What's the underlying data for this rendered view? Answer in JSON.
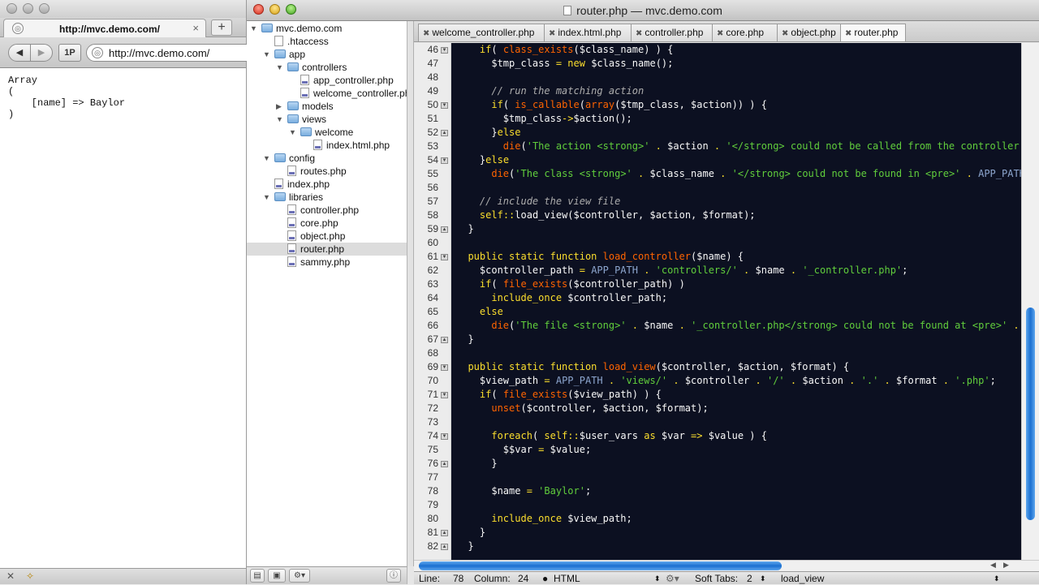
{
  "browser": {
    "tab_title": "http://mvc.demo.com/",
    "close_glyph": "×",
    "new_tab_glyph": "+",
    "back_glyph": "◀",
    "forward_glyph": "▶",
    "oneP_label": "1P",
    "url": "http://mvc.demo.com/",
    "page_output": "Array\n(\n    [name] => Baylor\n)",
    "status_left": "✕",
    "status_icon": "wand-icon"
  },
  "editor": {
    "window_title": "router.php — mvc.demo.com",
    "tree": [
      {
        "label": "mvc.demo.com",
        "type": "folder",
        "depth": 0,
        "open": true
      },
      {
        "label": ".htaccess",
        "type": "file",
        "depth": 1
      },
      {
        "label": "app",
        "type": "folder",
        "depth": 1,
        "open": true
      },
      {
        "label": "controllers",
        "type": "folder",
        "depth": 2,
        "open": true
      },
      {
        "label": "app_controller.php",
        "type": "php",
        "depth": 3
      },
      {
        "label": "welcome_controller.php",
        "type": "php",
        "depth": 3
      },
      {
        "label": "models",
        "type": "folder",
        "depth": 2,
        "open": false
      },
      {
        "label": "views",
        "type": "folder",
        "depth": 2,
        "open": true
      },
      {
        "label": "welcome",
        "type": "folder",
        "depth": 3,
        "open": true
      },
      {
        "label": "index.html.php",
        "type": "php",
        "depth": 4
      },
      {
        "label": "config",
        "type": "folder",
        "depth": 1,
        "open": true
      },
      {
        "label": "routes.php",
        "type": "php",
        "depth": 2
      },
      {
        "label": "index.php",
        "type": "php",
        "depth": 1
      },
      {
        "label": "libraries",
        "type": "folder",
        "depth": 1,
        "open": true
      },
      {
        "label": "controller.php",
        "type": "php",
        "depth": 2
      },
      {
        "label": "core.php",
        "type": "php",
        "depth": 2
      },
      {
        "label": "object.php",
        "type": "php",
        "depth": 2
      },
      {
        "label": "router.php",
        "type": "php",
        "depth": 2,
        "selected": true
      },
      {
        "label": "sammy.php",
        "type": "php",
        "depth": 2
      }
    ],
    "tabs": [
      {
        "label": "welcome_controller.php",
        "active": false
      },
      {
        "label": "index.html.php",
        "active": false
      },
      {
        "label": "controller.php",
        "active": false
      },
      {
        "label": "core.php",
        "active": false
      },
      {
        "label": "object.php",
        "active": false
      },
      {
        "label": "router.php",
        "active": true
      }
    ],
    "tab_close_glyph": "✖",
    "first_line_number": 46,
    "fold_open_lines": [
      46,
      50,
      54,
      61,
      69,
      71,
      74
    ],
    "fold_close_lines": [
      52,
      59,
      67,
      76,
      81,
      82
    ],
    "code_lines": [
      [
        [
          "    ",
          ""
        ],
        [
          "if",
          "kw"
        ],
        [
          "( ",
          ""
        ],
        [
          "class_exists",
          "fn"
        ],
        [
          "(",
          ""
        ],
        [
          "$class_name",
          "var"
        ],
        [
          ") ) {",
          ""
        ]
      ],
      [
        [
          "      ",
          ""
        ],
        [
          "$tmp_class",
          "var"
        ],
        [
          " = ",
          "op"
        ],
        [
          "new ",
          "kw"
        ],
        [
          "$class_name",
          "var"
        ],
        [
          "();",
          ""
        ]
      ],
      [
        [
          "",
          ""
        ]
      ],
      [
        [
          "      ",
          ""
        ],
        [
          "// run the matching action",
          "cmt"
        ]
      ],
      [
        [
          "      ",
          ""
        ],
        [
          "if",
          "kw"
        ],
        [
          "( ",
          ""
        ],
        [
          "is_callable",
          "fn"
        ],
        [
          "(",
          ""
        ],
        [
          "array",
          "fn"
        ],
        [
          "(",
          ""
        ],
        [
          "$tmp_class",
          "var"
        ],
        [
          ", ",
          ""
        ],
        [
          "$action",
          "var"
        ],
        [
          ")) ) {",
          ""
        ]
      ],
      [
        [
          "        ",
          ""
        ],
        [
          "$tmp_class",
          "var"
        ],
        [
          "->",
          "op"
        ],
        [
          "$action",
          "var"
        ],
        [
          "();",
          ""
        ]
      ],
      [
        [
          "      ",
          ""
        ],
        [
          "}",
          ""
        ],
        [
          "else",
          "kw"
        ]
      ],
      [
        [
          "        ",
          ""
        ],
        [
          "die",
          "fn"
        ],
        [
          "(",
          ""
        ],
        [
          "'The action <strong>'",
          "str"
        ],
        [
          " . ",
          "op"
        ],
        [
          "$action",
          "var"
        ],
        [
          " . ",
          "op"
        ],
        [
          "'</strong> could not be called from the controller",
          "str"
        ]
      ],
      [
        [
          "    ",
          ""
        ],
        [
          "}",
          ""
        ],
        [
          "else",
          "kw"
        ]
      ],
      [
        [
          "      ",
          ""
        ],
        [
          "die",
          "fn"
        ],
        [
          "(",
          ""
        ],
        [
          "'The class <strong>'",
          "str"
        ],
        [
          " . ",
          "op"
        ],
        [
          "$class_name",
          "var"
        ],
        [
          " . ",
          "op"
        ],
        [
          "'</strong> could not be found in <pre>'",
          "str"
        ],
        [
          " . ",
          "op"
        ],
        [
          "APP_PATH",
          "cst"
        ]
      ],
      [
        [
          "",
          ""
        ]
      ],
      [
        [
          "    ",
          ""
        ],
        [
          "// include the view file",
          "cmt"
        ]
      ],
      [
        [
          "    ",
          ""
        ],
        [
          "self",
          "kw"
        ],
        [
          "::",
          "op"
        ],
        [
          "load_view",
          "var"
        ],
        [
          "(",
          ""
        ],
        [
          "$controller",
          "var"
        ],
        [
          ", ",
          ""
        ],
        [
          "$action",
          "var"
        ],
        [
          ", ",
          ""
        ],
        [
          "$format",
          "var"
        ],
        [
          ");",
          ""
        ]
      ],
      [
        [
          "  }",
          ""
        ]
      ],
      [
        [
          "",
          ""
        ]
      ],
      [
        [
          "  ",
          ""
        ],
        [
          "public static function ",
          "kw"
        ],
        [
          "load_controller",
          "fn"
        ],
        [
          "(",
          ""
        ],
        [
          "$name",
          "var"
        ],
        [
          ") {",
          ""
        ]
      ],
      [
        [
          "    ",
          ""
        ],
        [
          "$controller_path",
          "var"
        ],
        [
          " = ",
          "op"
        ],
        [
          "APP_PATH",
          "cst"
        ],
        [
          " . ",
          "op"
        ],
        [
          "'controllers/'",
          "str"
        ],
        [
          " . ",
          "op"
        ],
        [
          "$name",
          "var"
        ],
        [
          " . ",
          "op"
        ],
        [
          "'_controller.php'",
          "str"
        ],
        [
          ";",
          ""
        ]
      ],
      [
        [
          "    ",
          ""
        ],
        [
          "if",
          "kw"
        ],
        [
          "( ",
          ""
        ],
        [
          "file_exists",
          "fn"
        ],
        [
          "(",
          ""
        ],
        [
          "$controller_path",
          "var"
        ],
        [
          ") )",
          ""
        ]
      ],
      [
        [
          "      ",
          ""
        ],
        [
          "include_once ",
          "kw"
        ],
        [
          "$controller_path",
          "var"
        ],
        [
          ";",
          ""
        ]
      ],
      [
        [
          "    ",
          ""
        ],
        [
          "else",
          "kw"
        ]
      ],
      [
        [
          "      ",
          ""
        ],
        [
          "die",
          "fn"
        ],
        [
          "(",
          ""
        ],
        [
          "'The file <strong>'",
          "str"
        ],
        [
          " . ",
          "op"
        ],
        [
          "$name",
          "var"
        ],
        [
          " . ",
          "op"
        ],
        [
          "'_controller.php</strong> could not be found at <pre>'",
          "str"
        ],
        [
          " . ",
          "op"
        ]
      ],
      [
        [
          "  }",
          ""
        ]
      ],
      [
        [
          "",
          ""
        ]
      ],
      [
        [
          "  ",
          ""
        ],
        [
          "public static function ",
          "kw"
        ],
        [
          "load_view",
          "fn"
        ],
        [
          "(",
          ""
        ],
        [
          "$controller",
          "var"
        ],
        [
          ", ",
          ""
        ],
        [
          "$action",
          "var"
        ],
        [
          ", ",
          ""
        ],
        [
          "$format",
          "var"
        ],
        [
          ") {",
          ""
        ]
      ],
      [
        [
          "    ",
          ""
        ],
        [
          "$view_path",
          "var"
        ],
        [
          " = ",
          "op"
        ],
        [
          "APP_PATH",
          "cst"
        ],
        [
          " . ",
          "op"
        ],
        [
          "'views/'",
          "str"
        ],
        [
          " . ",
          "op"
        ],
        [
          "$controller",
          "var"
        ],
        [
          " . ",
          "op"
        ],
        [
          "'/'",
          "str"
        ],
        [
          " . ",
          "op"
        ],
        [
          "$action",
          "var"
        ],
        [
          " . ",
          "op"
        ],
        [
          "'.'",
          "str"
        ],
        [
          " . ",
          "op"
        ],
        [
          "$format",
          "var"
        ],
        [
          " . ",
          "op"
        ],
        [
          "'.php'",
          "str"
        ],
        [
          ";",
          ""
        ]
      ],
      [
        [
          "    ",
          ""
        ],
        [
          "if",
          "kw"
        ],
        [
          "( ",
          ""
        ],
        [
          "file_exists",
          "fn"
        ],
        [
          "(",
          ""
        ],
        [
          "$view_path",
          "var"
        ],
        [
          ") ) {",
          ""
        ]
      ],
      [
        [
          "      ",
          ""
        ],
        [
          "unset",
          "fn"
        ],
        [
          "(",
          ""
        ],
        [
          "$controller",
          "var"
        ],
        [
          ", ",
          ""
        ],
        [
          "$action",
          "var"
        ],
        [
          ", ",
          ""
        ],
        [
          "$format",
          "var"
        ],
        [
          ");",
          ""
        ]
      ],
      [
        [
          "",
          ""
        ]
      ],
      [
        [
          "      ",
          ""
        ],
        [
          "foreach",
          "kw"
        ],
        [
          "( ",
          ""
        ],
        [
          "self",
          "kw"
        ],
        [
          "::",
          "op"
        ],
        [
          "$user_vars",
          "var"
        ],
        [
          " as ",
          "kw"
        ],
        [
          "$var",
          "var"
        ],
        [
          " => ",
          "op"
        ],
        [
          "$value",
          "var"
        ],
        [
          " ) {",
          ""
        ]
      ],
      [
        [
          "        ",
          ""
        ],
        [
          "$$var",
          "var"
        ],
        [
          " = ",
          "op"
        ],
        [
          "$value",
          "var"
        ],
        [
          ";",
          ""
        ]
      ],
      [
        [
          "      }",
          ""
        ]
      ],
      [
        [
          "",
          ""
        ]
      ],
      [
        [
          "      ",
          ""
        ],
        [
          "$name",
          "var"
        ],
        [
          " = ",
          "op"
        ],
        [
          "'Baylor'",
          "str"
        ],
        [
          ";",
          ""
        ]
      ],
      [
        [
          "",
          ""
        ]
      ],
      [
        [
          "      ",
          ""
        ],
        [
          "include_once ",
          "kw"
        ],
        [
          "$view_path",
          "var"
        ],
        [
          ";",
          ""
        ]
      ],
      [
        [
          "    }",
          ""
        ]
      ],
      [
        [
          "  }",
          ""
        ]
      ]
    ],
    "status": {
      "line_label": "Line:",
      "line_value": "78",
      "column_label": "Column:",
      "column_value": "24",
      "language": "HTML",
      "soft_tabs_label": "Soft Tabs:",
      "soft_tabs_value": "2",
      "symbol": "load_view"
    }
  }
}
